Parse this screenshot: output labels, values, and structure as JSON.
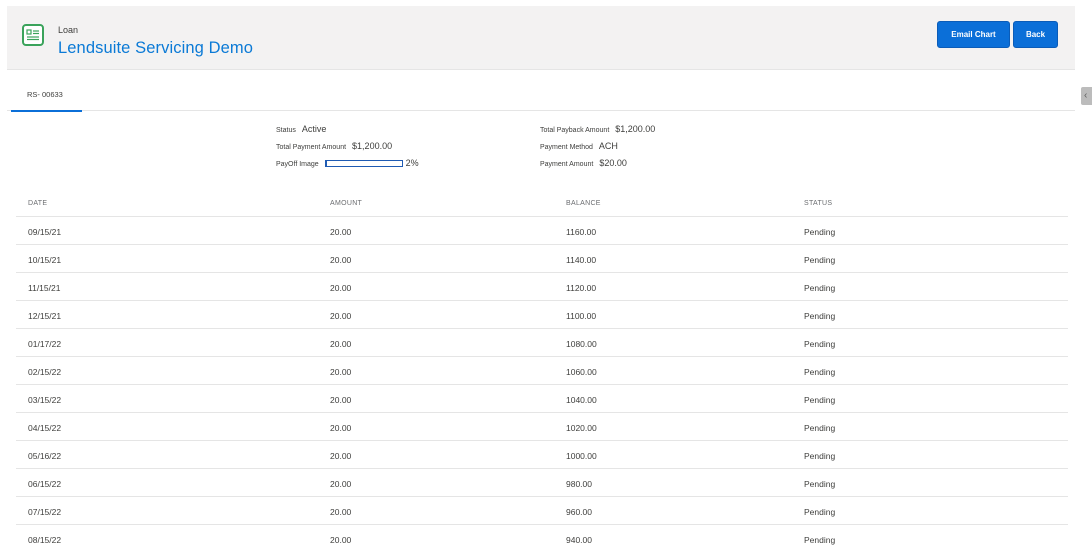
{
  "header": {
    "object_type": "Loan",
    "record_name": "Lendsuite Servicing Demo",
    "email_chart_label": "Email Chart",
    "back_label": "Back",
    "icon": "loan-record-icon",
    "accent_color": "#0b6fd8"
  },
  "tab": {
    "label": "RS- 00633"
  },
  "summary": {
    "status_label": "Status",
    "status_value": "Active",
    "total_payment_amount_label": "Total Payment Amount",
    "total_payment_amount_value": "$1,200.00",
    "payoff_image_label": "PayOff Image",
    "payoff_percent_text": "2%",
    "payoff_fraction": 0.02,
    "total_payback_amount_label": "Total Payback Amount",
    "total_payback_amount_value": "$1,200.00",
    "payment_method_label": "Payment Method",
    "payment_method_value": "ACH",
    "payment_amount_label": "Payment Amount",
    "payment_amount_value": "$20.00"
  },
  "schedule": {
    "columns": [
      "DATE",
      "AMOUNT",
      "BALANCE",
      "STATUS"
    ],
    "rows": [
      {
        "date": "09/15/21",
        "amount": "20.00",
        "balance": "1160.00",
        "status": "Pending"
      },
      {
        "date": "10/15/21",
        "amount": "20.00",
        "balance": "1140.00",
        "status": "Pending"
      },
      {
        "date": "11/15/21",
        "amount": "20.00",
        "balance": "1120.00",
        "status": "Pending"
      },
      {
        "date": "12/15/21",
        "amount": "20.00",
        "balance": "1100.00",
        "status": "Pending"
      },
      {
        "date": "01/17/22",
        "amount": "20.00",
        "balance": "1080.00",
        "status": "Pending"
      },
      {
        "date": "02/15/22",
        "amount": "20.00",
        "balance": "1060.00",
        "status": "Pending"
      },
      {
        "date": "03/15/22",
        "amount": "20.00",
        "balance": "1040.00",
        "status": "Pending"
      },
      {
        "date": "04/15/22",
        "amount": "20.00",
        "balance": "1020.00",
        "status": "Pending"
      },
      {
        "date": "05/16/22",
        "amount": "20.00",
        "balance": "1000.00",
        "status": "Pending"
      },
      {
        "date": "06/15/22",
        "amount": "20.00",
        "balance": "980.00",
        "status": "Pending"
      },
      {
        "date": "07/15/22",
        "amount": "20.00",
        "balance": "960.00",
        "status": "Pending"
      },
      {
        "date": "08/15/22",
        "amount": "20.00",
        "balance": "940.00",
        "status": "Pending"
      }
    ]
  },
  "side_panel_toggle_icon": "chevron-left-icon"
}
